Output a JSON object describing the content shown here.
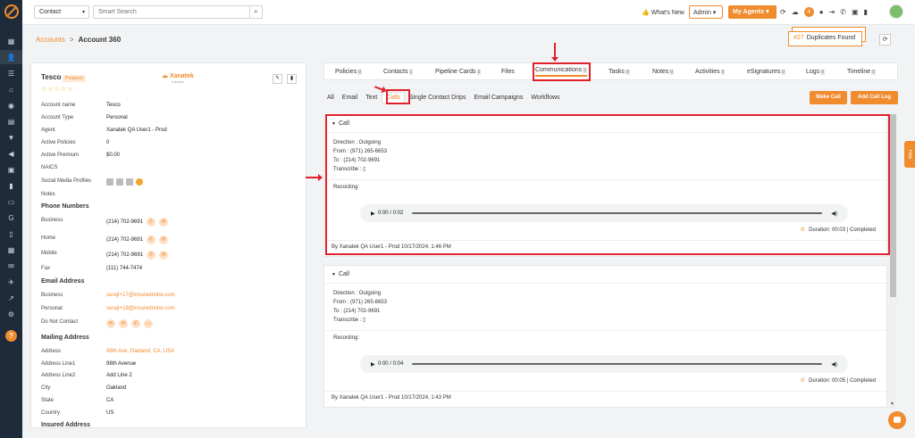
{
  "topbar": {
    "context_select": "Contact",
    "search_placeholder": "Smart Search",
    "whats_new": "What's New",
    "admin_select": "Admin",
    "my_agents": "My Agents"
  },
  "breadcrumb": {
    "parent": "Accounts",
    "separator": ">",
    "current": "Account 360"
  },
  "duplicates": {
    "count": "#27",
    "label": "Duplicates Found"
  },
  "account": {
    "name": "Tesco",
    "badge": "Prospect",
    "stars": "☆☆☆☆☆",
    "logo_text": "Xanatek",
    "logo_sub": "Insured",
    "fields": [
      {
        "k": "Account name",
        "v": "Tesco"
      },
      {
        "k": "Account Type",
        "v": "Personal"
      },
      {
        "k": "Agent",
        "v": "Xanatek QA User1 - Prod"
      },
      {
        "k": "Active Policies",
        "v": "0"
      },
      {
        "k": "Active Premium",
        "v": "$0.00"
      },
      {
        "k": "NAICS",
        "v": ""
      },
      {
        "k": "Social Media Profiles",
        "v": ""
      },
      {
        "k": "Notes",
        "v": ""
      }
    ],
    "phone_heading": "Phone Numbers",
    "phones": [
      {
        "k": "Business",
        "v": "(214) 702-9691"
      },
      {
        "k": "Home",
        "v": "(214) 702-9691"
      },
      {
        "k": "Mobile",
        "v": "(214) 702-9691"
      },
      {
        "k": "Fax",
        "v": "(111) 744-7474"
      }
    ],
    "email_heading": "Email Address",
    "emails": [
      {
        "k": "Business",
        "v": "surajt+17@insuredmine.com"
      },
      {
        "k": "Personal",
        "v": "surajt+18@insuredmine.com"
      },
      {
        "k": "Do Not Contact",
        "v": ""
      }
    ],
    "mailing_heading": "Mailing Address",
    "mailing": [
      {
        "k": "Address",
        "v": "98th Ave, Oakland, CA, USA"
      },
      {
        "k": "Address Line1",
        "v": "98th Avenue"
      },
      {
        "k": "Address Line2",
        "v": "Add Line 2"
      },
      {
        "k": "City",
        "v": "Oakland"
      },
      {
        "k": "State",
        "v": "CA"
      },
      {
        "k": "Country",
        "v": "US"
      }
    ],
    "insured_heading": "Insured Address"
  },
  "tabs": [
    {
      "label": "Policies",
      "count": "0"
    },
    {
      "label": "Contacts",
      "count": "1"
    },
    {
      "label": "Pipeline Cards",
      "count": "0"
    },
    {
      "label": "Files",
      "count": ""
    },
    {
      "label": "Communications",
      "count": "2"
    },
    {
      "label": "Tasks",
      "count": "0"
    },
    {
      "label": "Notes",
      "count": "0"
    },
    {
      "label": "Activities",
      "count": "0"
    },
    {
      "label": "eSignatures",
      "count": "0"
    },
    {
      "label": "Logs",
      "count": "0"
    },
    {
      "label": "Timeline",
      "count": "0"
    }
  ],
  "subtabs": [
    "All",
    "Email",
    "Text",
    "Calls",
    "Single Contact Drips",
    "Email Campaigns",
    "Workflows"
  ],
  "actions": {
    "make_call": "Make Call",
    "add_call_log": "Add Call Log"
  },
  "calls": [
    {
      "title": "Call",
      "direction": "Direction : Outgoing",
      "from": "From : (971) 265-6653",
      "to": "To : (214) 702-9691",
      "transcribe": "Transcribe :",
      "recording": "Recording:",
      "player_time": "0:00 / 0:02",
      "duration": "Duration: 00:03 | Completed",
      "footer": "By Xanatek QA User1 - Prod 10/17/2024, 1:46 PM"
    },
    {
      "title": "Call",
      "direction": "Direction : Outgoing",
      "from": "From : (971) 265-6653",
      "to": "To : (214) 702-9691",
      "transcribe": "Transcribe :",
      "recording": "Recording:",
      "player_time": "0:00 / 0:04",
      "duration": "Duration: 00:05 | Completed",
      "footer": "By Xanatek QA User1 - Prod 10/17/2024, 1:43 PM"
    }
  ],
  "help_tab": "Help"
}
